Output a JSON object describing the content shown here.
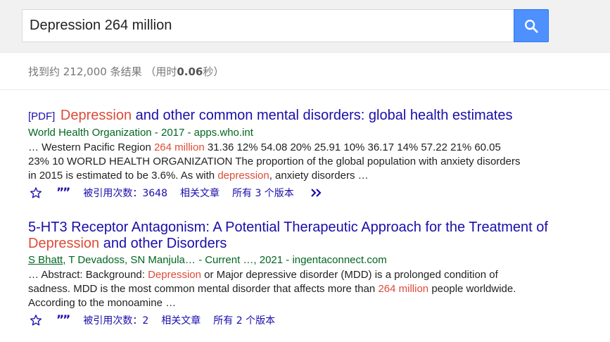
{
  "search": {
    "query": "Depression 264 million"
  },
  "stats": {
    "prefix": "找到约 212,000 条结果 （用时",
    "time": "0.06",
    "suffix": "秒）"
  },
  "colors": {
    "link": "#1a0dab",
    "source": "#006621",
    "highlight": "#dd4b39",
    "search_button": "#4d90fe"
  },
  "results": [
    {
      "pdf_tag": "[PDF]",
      "title_hl": "Depression",
      "title_rest": " and other common mental disorders: global health estimates",
      "source": "World Health Organization - 2017 - apps.who.int",
      "snippet": {
        "p1": "… Western Pacific Region ",
        "hl1": "264 million",
        "p2": " 31.36 12% 54.08 20% 25.91 10% 36.17 14% 57.22 21% 60.05 23% 10 WORLD HEALTH ORGANIZATION The proportion of the global population with anxiety disorders in 2015 is estimated to be 3.6%. As with ",
        "hl2": "depression",
        "p3": ", anxiety disorders …"
      },
      "actions": {
        "cited": "被引用次数：3648",
        "related": "相关文章",
        "versions": "所有 3 个版本"
      }
    },
    {
      "title_a": "5-HT3 Receptor Antagonism: A Potential Therapeutic Approach for the Treatment of ",
      "title_hl": "Depression",
      "title_b": " and other Disorders",
      "source_author": "S Bhatt",
      "source_rest": ", T Devadoss, SN Manjula… - Current …, 2021 - ingentaconnect.com",
      "snippet": {
        "p1": "… Abstract: Background: ",
        "hl1": "Depression",
        "p2": " or Major depressive disorder (MDD) is a prolonged condition of sadness. MDD is the most common mental disorder that affects more than ",
        "hl2": "264 million",
        "p3": " people worldwide. According to the monoamine …"
      },
      "actions": {
        "cited": "被引用次数：2",
        "related": "相关文章",
        "versions": "所有 2 个版本"
      }
    }
  ],
  "icons": {
    "search": "search-icon",
    "save": "star-icon",
    "cite": "quote-icon",
    "more": "double-chevron-right-icon"
  }
}
